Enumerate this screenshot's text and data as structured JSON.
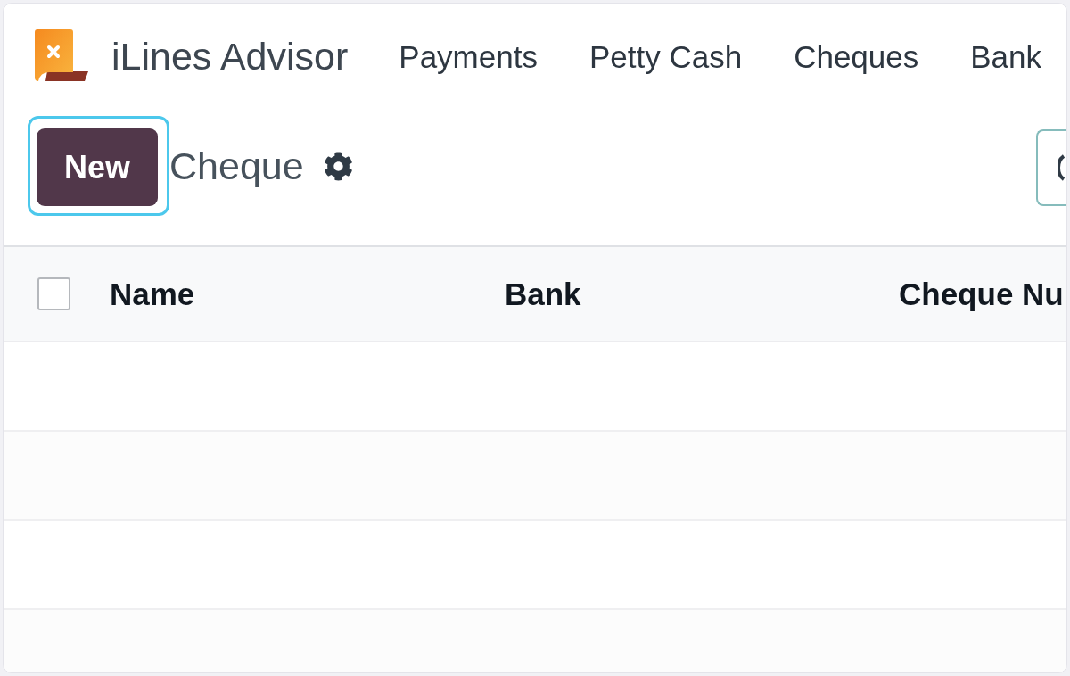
{
  "navbar": {
    "app_name": "iLines Advisor",
    "menu": [
      {
        "label": "Payments"
      },
      {
        "label": "Petty Cash"
      },
      {
        "label": "Cheques"
      },
      {
        "label": "Bank"
      }
    ]
  },
  "control_panel": {
    "new_button": {
      "label": "New",
      "focused": true
    },
    "title": "Cheque"
  },
  "table": {
    "select_all": {
      "checked": false
    },
    "columns": [
      "Name",
      "Bank",
      "Cheque Nu"
    ]
  }
}
